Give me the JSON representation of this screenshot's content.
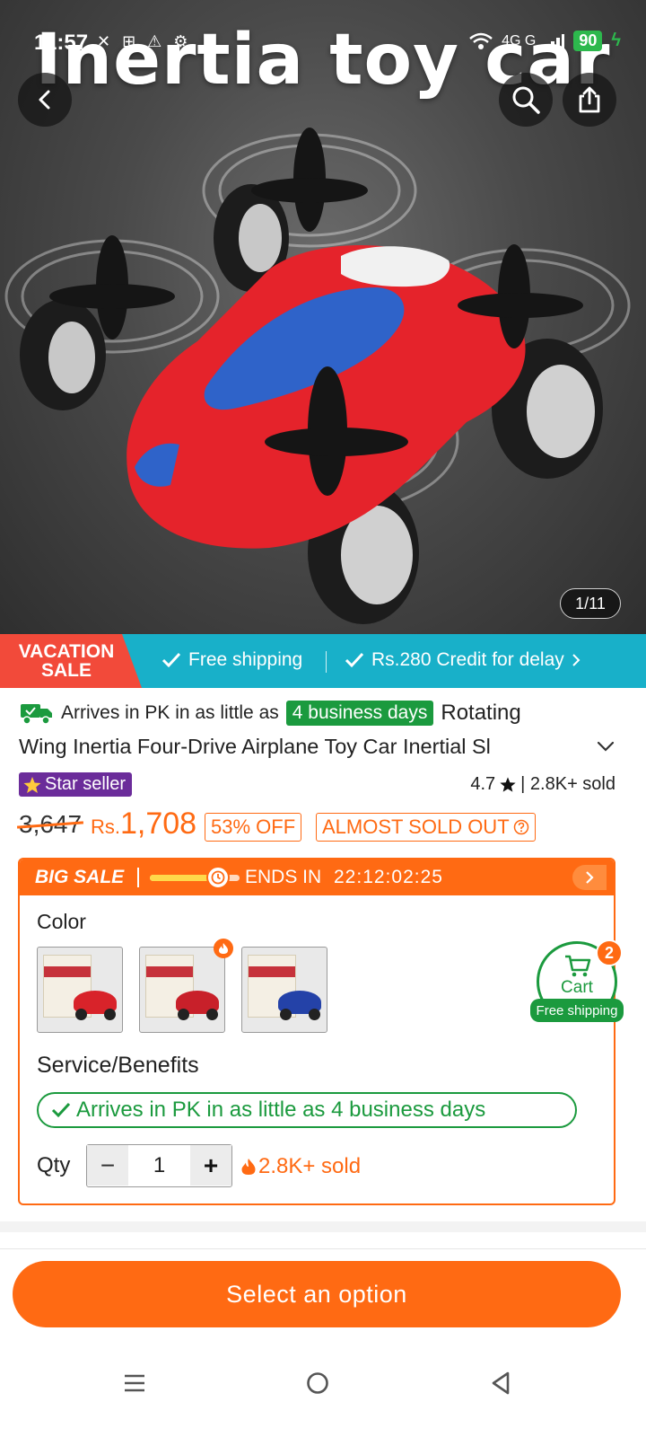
{
  "status_bar": {
    "time": "11:57",
    "left_icons": "✕ ⊞ ⚠ ⚙",
    "network": "4G G",
    "battery": "90"
  },
  "hero": {
    "title": "Inertia toy car",
    "counter": "1/11"
  },
  "promo": {
    "vacation_line1": "VACATION",
    "vacation_line2": "SALE",
    "free_shipping": "Free shipping",
    "credit": "Rs.280 Credit for delay"
  },
  "product": {
    "arrival_prefix": "Arrives in PK in as little as",
    "arrival_days": "4 business days",
    "title_part1": "Rotating",
    "title_part2": "Wing Inertia Four-Drive Airplane Toy Car Inertial Sl",
    "star_seller": "Star seller",
    "rating": "4.7",
    "sold": "| 2.8K+ sold",
    "old_price": "3,647",
    "currency": "Rs.",
    "price": "1,708",
    "discount": "53% OFF",
    "stock_status": "ALMOST SOLD OUT"
  },
  "sale": {
    "label": "BIG SALE",
    "progress": 0.75,
    "ends_label": "ENDS IN",
    "ends_time": "22:12:02:25"
  },
  "options": {
    "color_label": "Color",
    "colors": [
      {
        "name": "red",
        "hex": "#d8232a"
      },
      {
        "name": "red-black",
        "hex": "#c8202a"
      },
      {
        "name": "blue",
        "hex": "#2442a8"
      }
    ],
    "service_label": "Service/Benefits",
    "service_text": "Arrives in PK in as little as 4 business days",
    "qty_label": "Qty",
    "qty_value": "1",
    "qty_sold": "2.8K+ sold"
  },
  "cart": {
    "label": "Cart",
    "badge": "2",
    "free_shipping": "Free shipping"
  },
  "actions": {
    "select_option": "Select an option"
  },
  "colors": {
    "accent": "#ff6a13",
    "green": "#1b9a3e",
    "teal": "#18b0c9",
    "sale_red": "#f24a3a",
    "purple": "#6b2c9a"
  }
}
